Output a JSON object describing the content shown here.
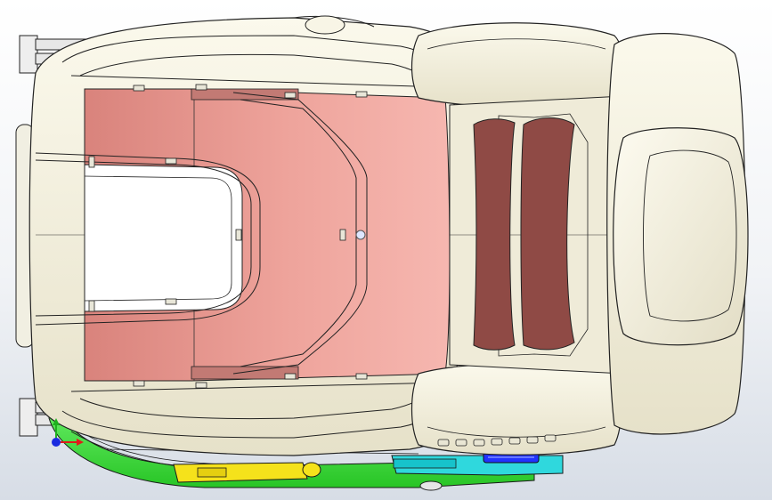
{
  "viewport": {
    "background_top": "#ffffff",
    "background_bottom": "#d7dde6"
  },
  "model": {
    "kind": "seat assembly (top view)",
    "colors": {
      "shell": "#f4f1df",
      "shell_shadow": "#ddd8c3",
      "edge": "#2a2a2a",
      "seat_panel": "#e4948c",
      "seat_panel_light": "#f3b0a8",
      "backrest_pads": "#8f4a45",
      "frame_green": "#41e23b",
      "bracket_yellow": "#f5e21b",
      "bracket_cyan": "#2fd8dd",
      "bracket_blue": "#2233ff",
      "rail_gray": "#d9d9d9"
    }
  },
  "triad": {
    "icon": "coordinate-triad-icon",
    "x_color": "#e01b1b",
    "y_color": "#1fb11f",
    "z_color": "#1b2be0"
  }
}
